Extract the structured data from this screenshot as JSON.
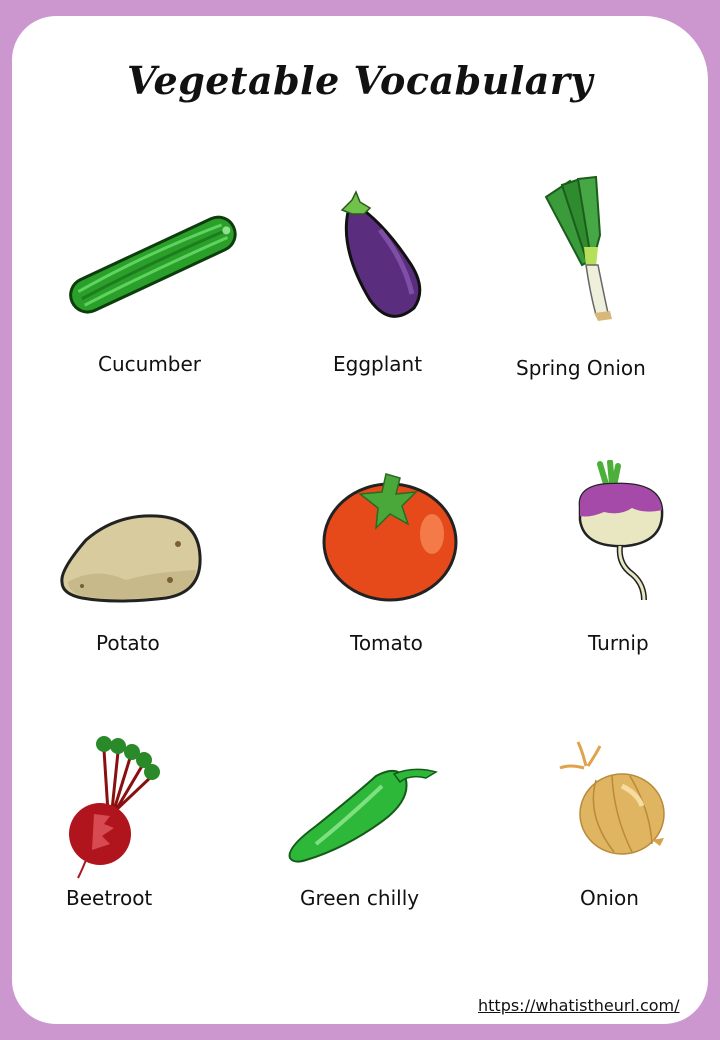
{
  "page": {
    "title": "Vegetable Vocabulary",
    "footer_url": "https://whatistheurl.com/",
    "colors": {
      "border": "#cc96cf",
      "background": "#ffffff"
    }
  },
  "vegetables": [
    {
      "name": "Cucumber",
      "icon": "cucumber-icon"
    },
    {
      "name": "Eggplant",
      "icon": "eggplant-icon"
    },
    {
      "name": "Spring Onion",
      "icon": "spring-onion-icon"
    },
    {
      "name": "Potato",
      "icon": "potato-icon"
    },
    {
      "name": "Tomato",
      "icon": "tomato-icon"
    },
    {
      "name": "Turnip",
      "icon": "turnip-icon"
    },
    {
      "name": "Beetroot",
      "icon": "beetroot-icon"
    },
    {
      "name": "Green chilly",
      "icon": "green-chilly-icon"
    },
    {
      "name": "Onion",
      "icon": "onion-icon"
    }
  ]
}
